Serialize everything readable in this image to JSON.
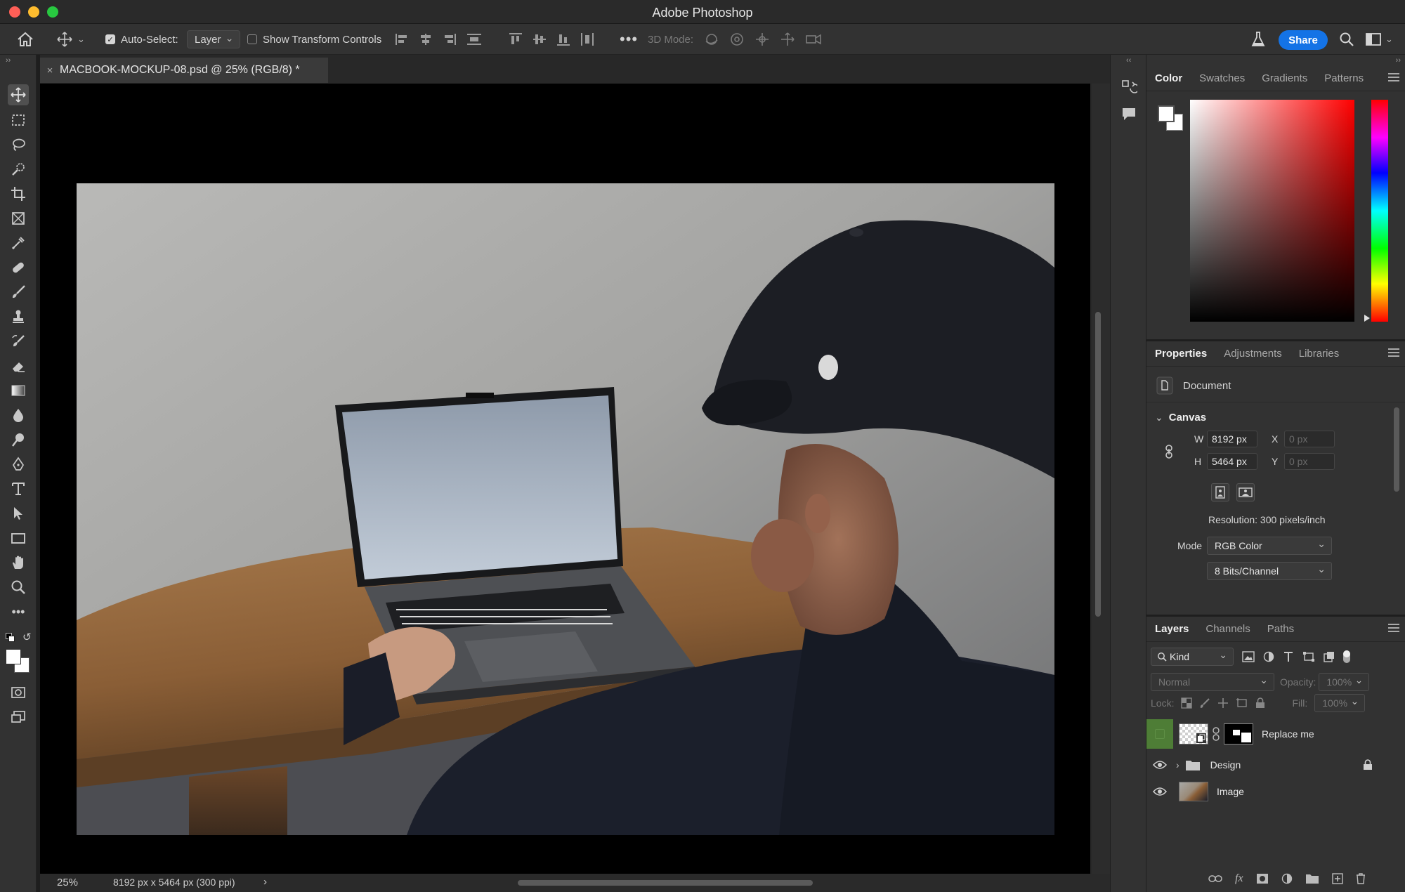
{
  "window": {
    "title": "Adobe Photoshop"
  },
  "options_bar": {
    "auto_select_label": "Auto-Select:",
    "auto_select_target": "Layer",
    "show_transform_label": "Show Transform Controls",
    "mode_3d_label": "3D Mode:",
    "share_label": "Share"
  },
  "document": {
    "tab_title": "MACBOOK-MOCKUP-08.psd @ 25% (RGB/8) *",
    "close_glyph": "×",
    "zoom": "25%",
    "info": "8192 px x 5464 px (300 ppi)",
    "info_arrow": "›"
  },
  "color_panel": {
    "tabs": [
      "Color",
      "Swatches",
      "Gradients",
      "Patterns"
    ],
    "active_tab": "Color",
    "colors": {
      "foreground": "#ffffff",
      "background": "#ffffff",
      "hue": "#ff0000"
    }
  },
  "properties_panel": {
    "tabs": [
      "Properties",
      "Adjustments",
      "Libraries"
    ],
    "active_tab": "Properties",
    "doc_label": "Document",
    "canvas_section": "Canvas",
    "width_label": "W",
    "width": "8192 px",
    "height_label": "H",
    "height": "5464 px",
    "x_label": "X",
    "x": "0 px",
    "y_label": "Y",
    "y": "0 px",
    "resolution": "Resolution: 300 pixels/inch",
    "mode_label": "Mode",
    "mode": "RGB Color",
    "bit_depth": "8 Bits/Channel"
  },
  "layers_panel": {
    "tabs": [
      "Layers",
      "Channels",
      "Paths"
    ],
    "active_tab": "Layers",
    "filter_kind": "Kind",
    "blend_mode": "Normal",
    "opacity_label": "Opacity:",
    "opacity": "100%",
    "lock_label": "Lock:",
    "fill_label": "Fill:",
    "fill": "100%",
    "layers": [
      {
        "name": "Replace me"
      },
      {
        "name": "Design"
      },
      {
        "name": "Image"
      }
    ]
  }
}
